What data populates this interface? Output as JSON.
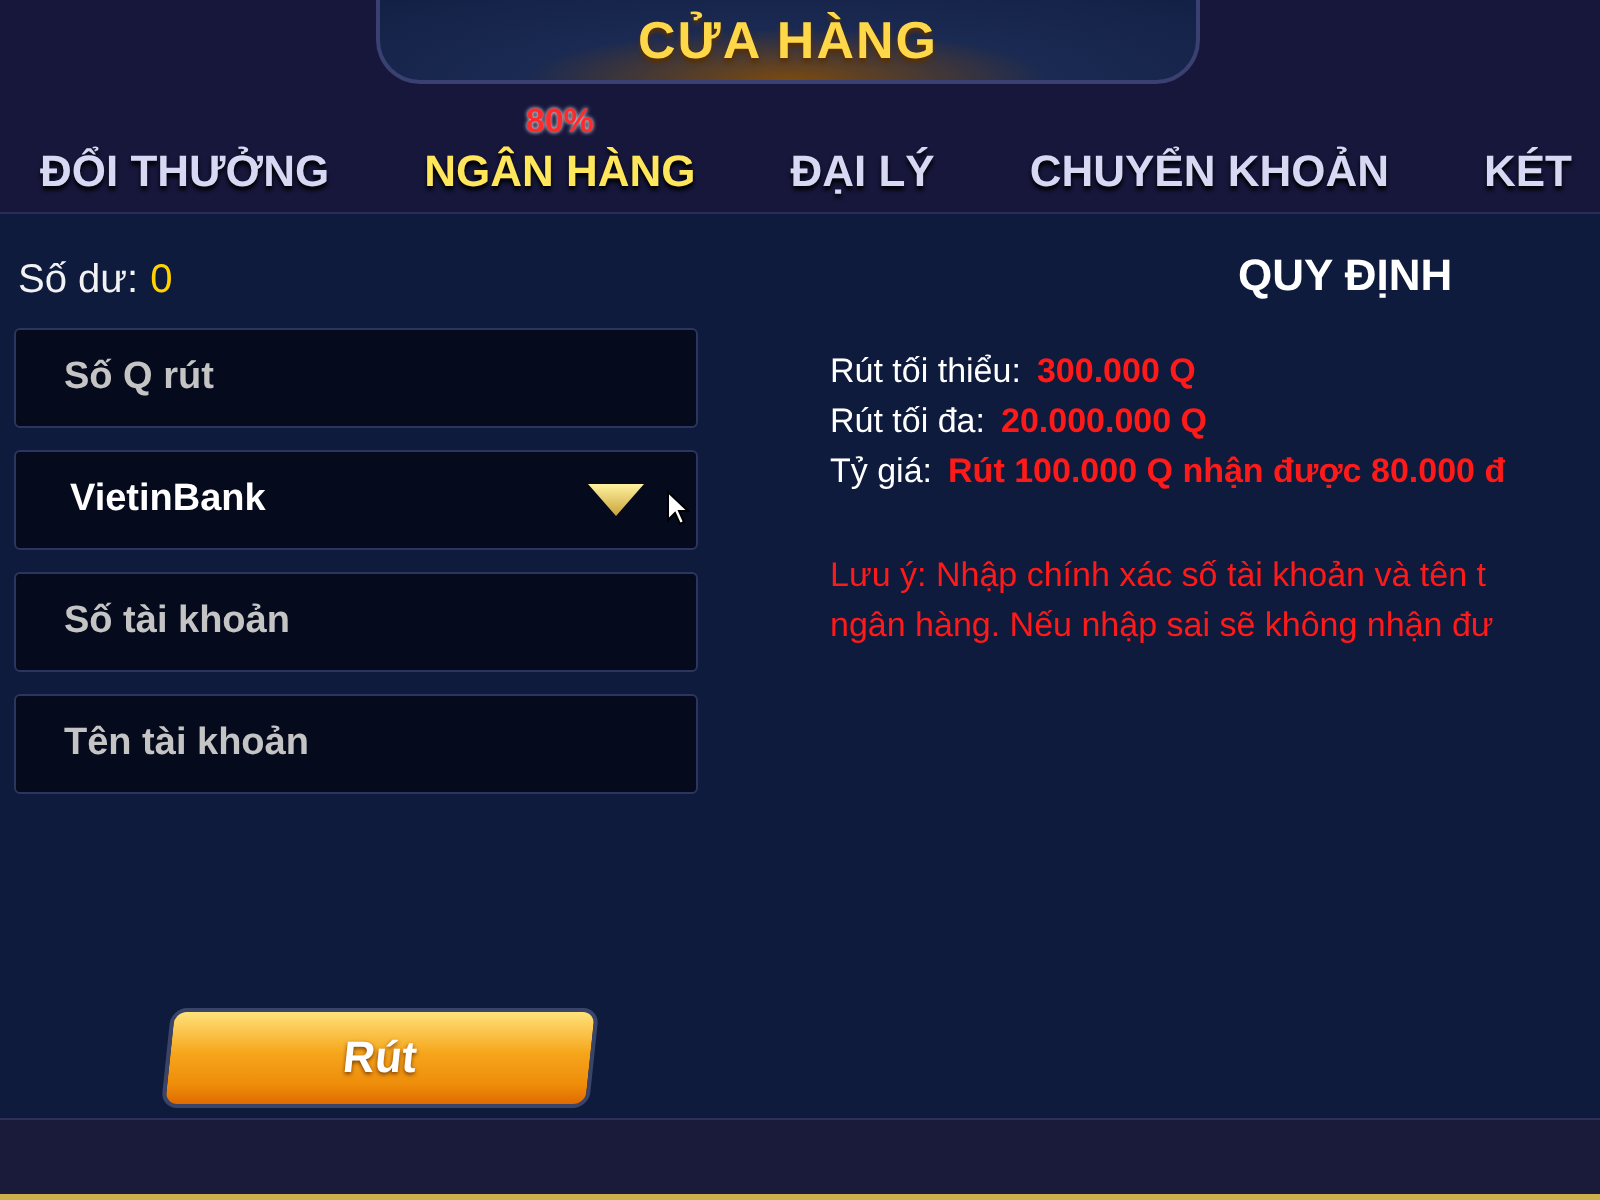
{
  "header": {
    "title": "CỬA HÀNG"
  },
  "tabs": [
    {
      "label": "ĐỔI THƯỞNG",
      "selected": false
    },
    {
      "label": "NGÂN HÀNG",
      "selected": true,
      "badge": "80%"
    },
    {
      "label": "ĐẠI LÝ",
      "selected": false
    },
    {
      "label": "CHUYỂN KHOẢN",
      "selected": false
    },
    {
      "label": "KÉT",
      "selected": false
    }
  ],
  "balance": {
    "label": "Số dư:",
    "value": "0"
  },
  "form": [
    {
      "kind": "input",
      "placeholder": "Số Q rút"
    },
    {
      "kind": "select",
      "value": "VietinBank"
    },
    {
      "kind": "input",
      "placeholder": "Số tài khoản"
    },
    {
      "kind": "input",
      "placeholder": "Tên tài khoản"
    }
  ],
  "submit_button": "Rút",
  "rules": {
    "title": "QUY ĐỊNH",
    "items": [
      {
        "label": "Rút tối thiểu:",
        "value": "300.000 Q"
      },
      {
        "label": "Rút tối đa:",
        "value": "20.000.000 Q"
      },
      {
        "label": "Tỷ giá:",
        "value": "Rút 100.000 Q nhận được 80.000 đ"
      }
    ],
    "note_lines": [
      "Lưu ý: Nhập chính xác số tài khoản và tên t",
      "ngân hàng. Nếu nhập sai sẽ không nhận đư"
    ]
  }
}
